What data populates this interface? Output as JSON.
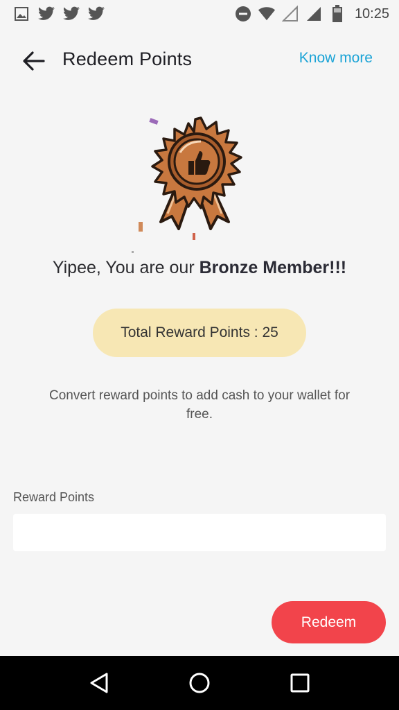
{
  "status_bar": {
    "time": "10:25",
    "left_icons": [
      "image-icon",
      "twitter-icon",
      "twitter-icon",
      "twitter-icon"
    ],
    "right_icons": [
      "do-not-disturb-icon",
      "wifi-icon",
      "signal-empty-icon",
      "signal-icon",
      "battery-icon"
    ]
  },
  "header": {
    "title": "Redeem Points",
    "know_more": "Know more"
  },
  "membership": {
    "headline_prefix": "Yipee, You are our ",
    "tier_text": "Bronze Member!!!",
    "badge_colors": {
      "bronze": "#c8783f",
      "dark": "#2a1a10",
      "light": "#f0c49a"
    }
  },
  "points": {
    "total_label": "Total Reward Points : 25",
    "note": "Convert reward points to add cash to your wallet for free."
  },
  "form": {
    "field_label": "Reward Points",
    "input_value": "",
    "input_placeholder": ""
  },
  "actions": {
    "redeem_label": "Redeem"
  },
  "colors": {
    "accent_link": "#1aa3d6",
    "primary_button": "#f2444b",
    "pill_bg": "#f7e7b4",
    "background": "#f5f5f5"
  },
  "nav_bar": {
    "buttons": [
      "back-triangle-icon",
      "home-circle-icon",
      "recents-square-icon"
    ]
  }
}
